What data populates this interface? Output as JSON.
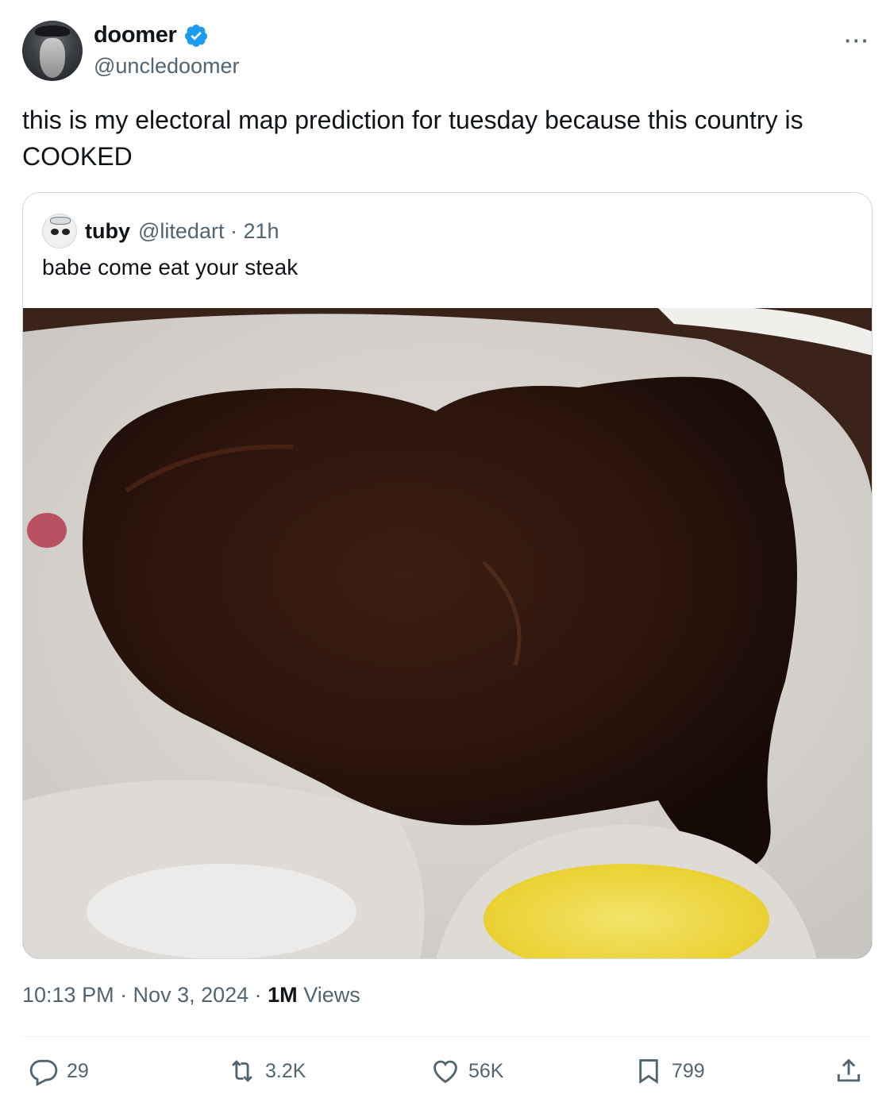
{
  "author": {
    "display_name": "doomer",
    "handle": "@uncledoomer",
    "verified_icon": "verified-badge-icon",
    "more_label": "···"
  },
  "tweet": {
    "text": "this is my electoral map prediction for tuesday because this country is COOKED"
  },
  "quote": {
    "display_name": "tuby",
    "handle_time": "@litedart · 21h",
    "text": "babe come eat your steak"
  },
  "meta": {
    "time_date": "10:13 PM · Nov 3, 2024 · ",
    "views_count": "1M",
    "views_label": "Views"
  },
  "actions": {
    "replies": "29",
    "reposts": "3.2K",
    "likes": "56K",
    "bookmarks": "799"
  },
  "colors": {
    "verified": "#1d9bf0",
    "secondary_text": "#536471",
    "border": "#cfd9de"
  }
}
